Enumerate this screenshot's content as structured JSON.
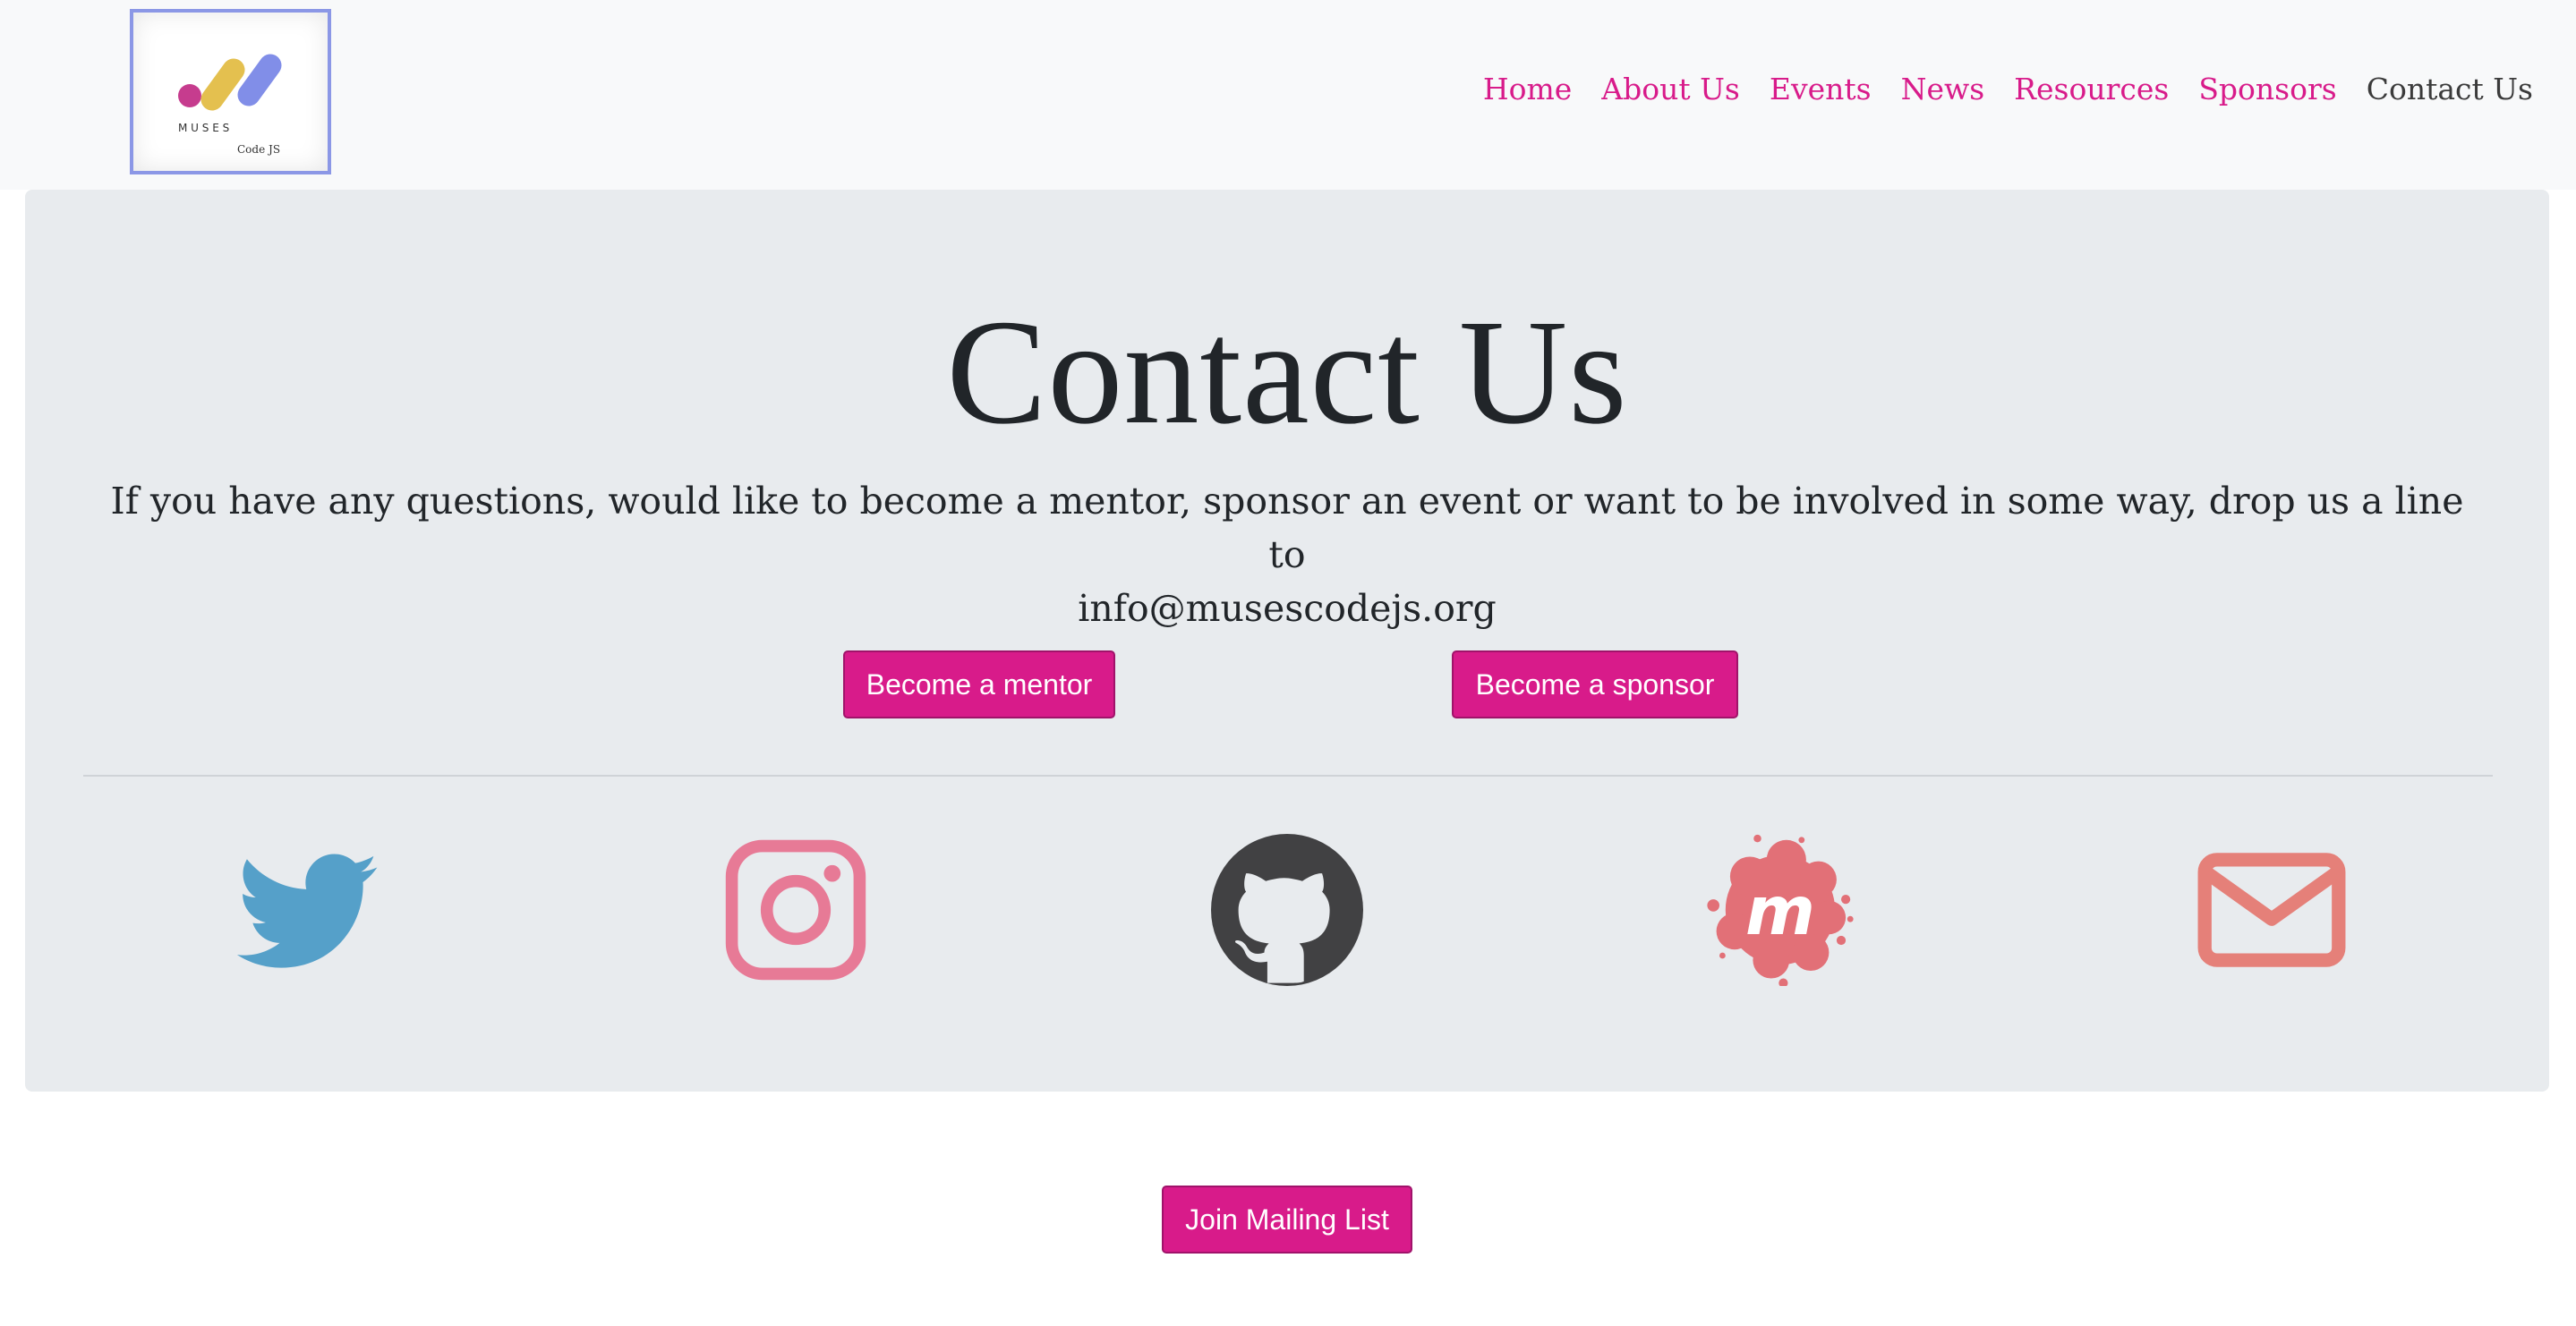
{
  "logo": {
    "wordmark": "M U S E S",
    "subtitle": "Code JS",
    "dot_colors": [
      "#c63c8e",
      "#e4c04f",
      "#818ee8"
    ]
  },
  "nav": {
    "items": [
      {
        "label": "Home",
        "active": false
      },
      {
        "label": "About Us",
        "active": false
      },
      {
        "label": "Events",
        "active": false
      },
      {
        "label": "News",
        "active": false
      },
      {
        "label": "Resources",
        "active": false
      },
      {
        "label": "Sponsors",
        "active": false
      },
      {
        "label": "Contact Us",
        "active": true
      }
    ]
  },
  "main": {
    "title": "Contact Us",
    "lead_line1": "If you have any questions, would like to become a mentor, sponsor an event or want to be involved in some way, drop us a line to",
    "lead_line2": "info@musescodejs.org",
    "buttons": {
      "mentor": "Become a mentor",
      "sponsor": "Become a sponsor"
    },
    "social_icons": [
      {
        "name": "twitter-icon",
        "color": "#55a0c9"
      },
      {
        "name": "instagram-icon",
        "color": "#e77a96"
      },
      {
        "name": "github-icon",
        "color": "#414143"
      },
      {
        "name": "meetup-icon",
        "color": "#e27077"
      },
      {
        "name": "email-icon",
        "color": "#e58079"
      }
    ]
  },
  "footer": {
    "mailing_list_label": "Join Mailing List"
  },
  "colors": {
    "accent": "#d81b8a",
    "navbar_bg": "#f8f9fa",
    "jumbotron_bg": "#e8ebee",
    "text": "#212529"
  }
}
